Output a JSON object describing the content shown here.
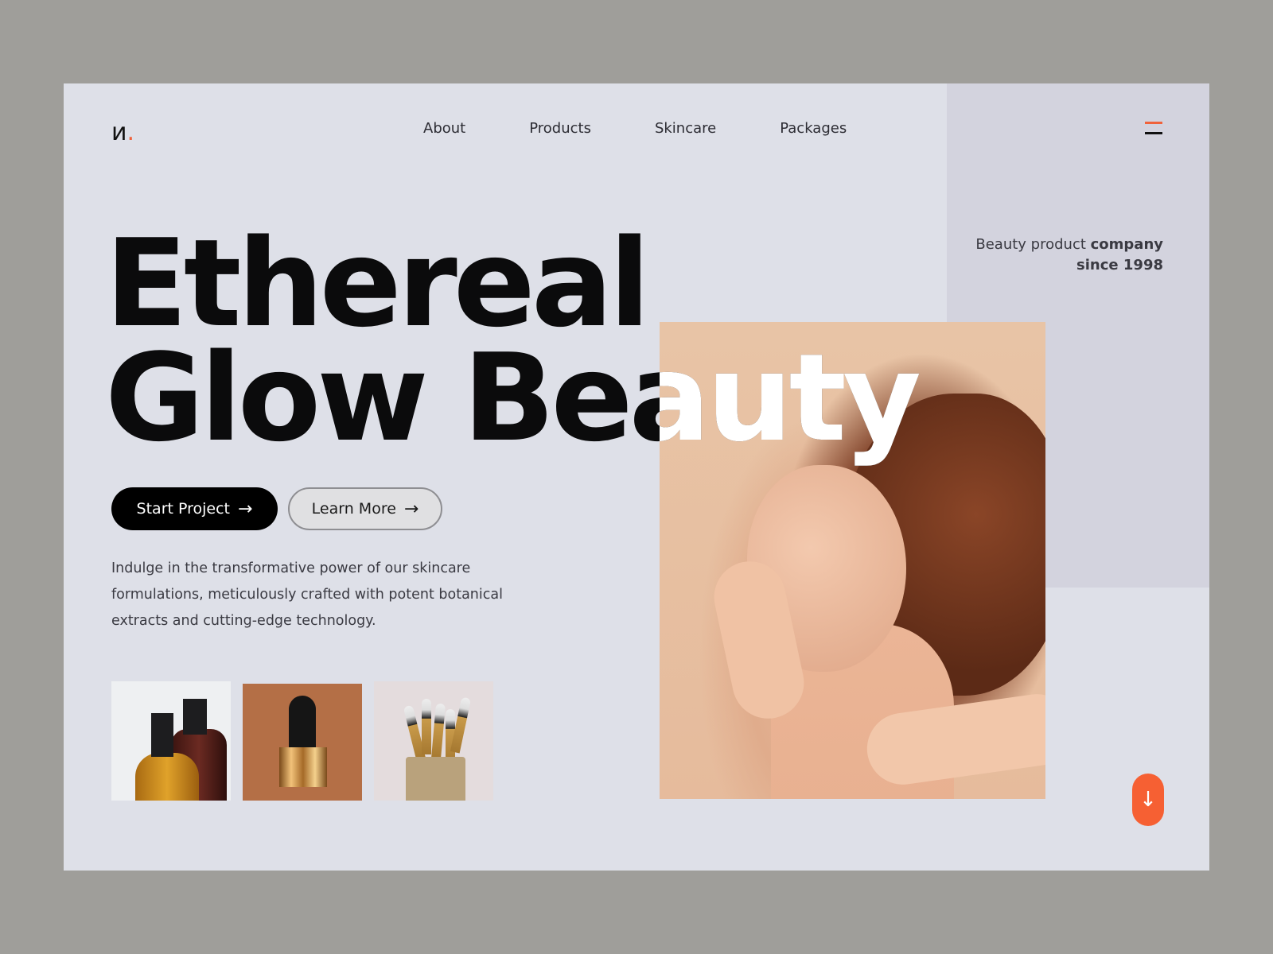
{
  "brand": {
    "logo_letter": "и",
    "logo_dot": ".",
    "accent_color": "#f0623b"
  },
  "nav": {
    "items": [
      {
        "label": "About"
      },
      {
        "label": "Products"
      },
      {
        "label": "Skincare"
      },
      {
        "label": "Packages"
      }
    ],
    "menu_icon": "hamburger-menu-icon"
  },
  "tagline": {
    "regular": "Beauty product ",
    "bold_1": "company",
    "bold_2": "since 1998"
  },
  "hero": {
    "line1": "Ethereal",
    "line2": "Glow Beauty"
  },
  "buttons": {
    "primary": {
      "label": "Start Project",
      "icon": "→"
    },
    "secondary": {
      "label": "Learn More",
      "icon": "→"
    }
  },
  "description": "Indulge in the transformative power of our skincare formulations, meticulously crafted with potent botanical extracts and cutting-edge technology.",
  "thumbnails": [
    {
      "alt": "pump bottles"
    },
    {
      "alt": "dropper serum bottle"
    },
    {
      "alt": "makeup brushes"
    }
  ],
  "scroll_button": {
    "icon": "↓"
  }
}
